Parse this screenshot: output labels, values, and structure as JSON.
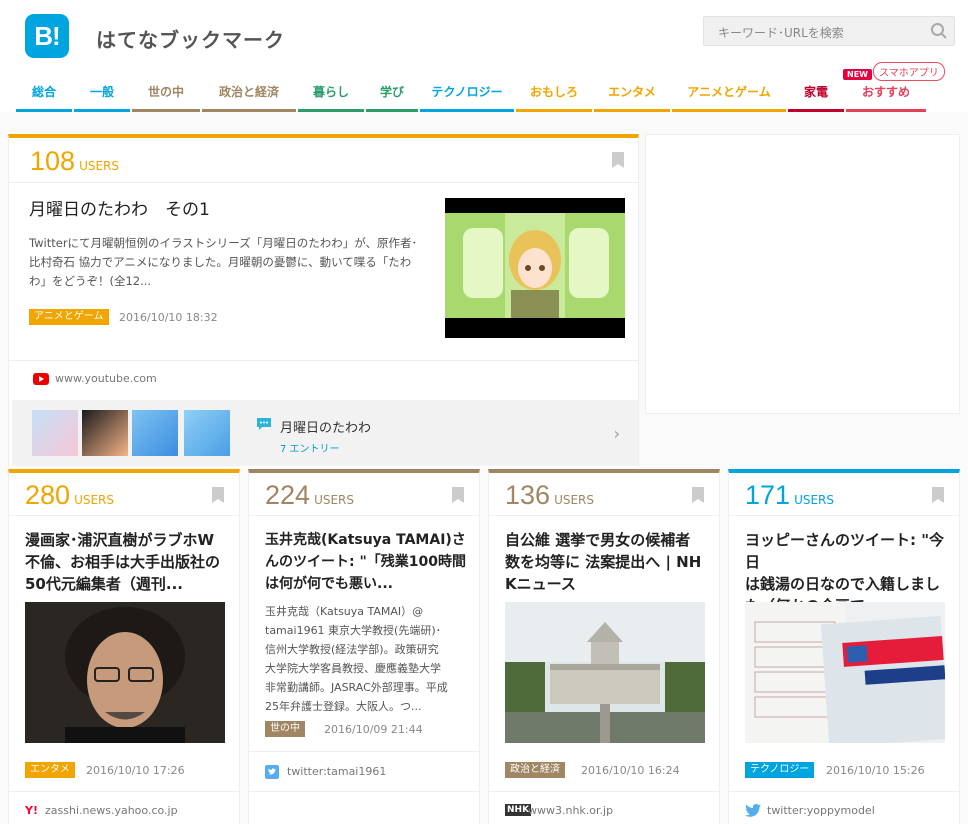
{
  "header": {
    "logo_text": "B!",
    "site_name": "はてなブックマーク",
    "search_placeholder": "キーワード･URLを検索",
    "badge_new": "NEW",
    "badge_app": "スマホアプリ"
  },
  "nav": [
    {
      "label": "総合",
      "color": "#00a4de"
    },
    {
      "label": "一般",
      "color": "#00a4de"
    },
    {
      "label": "世の中",
      "color": "#a08663"
    },
    {
      "label": "政治と経済",
      "color": "#a08663"
    },
    {
      "label": "暮らし",
      "color": "#2a9d6a"
    },
    {
      "label": "学び",
      "color": "#2a9d6a"
    },
    {
      "label": "テクノロジー",
      "color": "#00a4de"
    },
    {
      "label": "おもしろ",
      "color": "#f0a500"
    },
    {
      "label": "エンタメ",
      "color": "#f0a500"
    },
    {
      "label": "アニメとゲーム",
      "color": "#f0a500"
    },
    {
      "label": "家電",
      "color": "#c0002a"
    },
    {
      "label": "おすすめ",
      "color": "#e4405a"
    }
  ],
  "top_entry": {
    "users": "108",
    "users_label": "USERS",
    "title": "月曜日のたわわ　その1",
    "desc_lines": [
      "Twitterにて月曜朝恒例のイラストシリーズ「月曜日のたわわ」が、原作者･",
      "比村奇石 協力でアニメになりました。月曜朝の憂鬱に、動いて喋る「たわ",
      "わ」をどうぞ！(全12..."
    ],
    "category": "アニメとゲーム",
    "date": "2016/10/10 18:32",
    "source": "www.youtube.com",
    "related_title": "月曜日のたわわ",
    "related_count": "7 エントリー"
  },
  "cards": [
    {
      "users": "280",
      "users_label": "USERS",
      "color": "#f0a500",
      "title_lines": [
        "漫画家･浦沢直樹がラブホW",
        "不倫、お相手は大手出版社の",
        "50代元編集者（週刊..."
      ],
      "category": "エンタメ",
      "cat_color": "#f0a500",
      "date": "2016/10/10 17:26",
      "source": "zasshi.news.yahoo.co.jp"
    },
    {
      "users": "224",
      "users_label": "USERS",
      "color": "#a08663",
      "title_lines": [
        "玉井克哉(Katsuya TAMAI)さ",
        "んのツイート: \"「残業100時間",
        "は何が何でも悪い..."
      ],
      "desc_lines": [
        "玉井克哉（Katsuya TAMAI）@",
        "tamai1961 東京大学教授(先端研)･",
        "信州大学教授(経法学部)。政策研究",
        "大学院大学客員教授、慶應義塾大学",
        "非常勤講師。JASRAC外部理事。平成",
        "25年弁護士登録。大阪人。つ..."
      ],
      "category": "世の中",
      "cat_color": "#a08663",
      "date": "2016/10/09 21:44",
      "source": "twitter:tamai1961"
    },
    {
      "users": "136",
      "users_label": "USERS",
      "color": "#a08663",
      "title_lines": [
        "自公維 選挙で男女の候補者",
        "数を均等に 法案提出へ | NH",
        "Kニュース"
      ],
      "category": "政治と経済",
      "cat_color": "#a08663",
      "date": "2016/10/10 16:24",
      "source": "www3.nhk.or.jp"
    },
    {
      "users": "171",
      "users_label": "USERS",
      "color": "#00a4de",
      "title_lines": [
        "ヨッピーさんのツイート: \"今日",
        "は銭湯の日なので入籍しまし",
        "た（何かの企画で..."
      ],
      "category": "テクノロジー",
      "cat_color": "#00a4de",
      "date": "2016/10/10 15:26",
      "source": "twitter:yoppymodel"
    }
  ],
  "icon_names": [
    "search-icon",
    "bookmark-icon",
    "youtube-icon",
    "comment-icon",
    "chevron-right-icon",
    "yahoo-icon",
    "twitter-icon",
    "nhk-icon"
  ]
}
